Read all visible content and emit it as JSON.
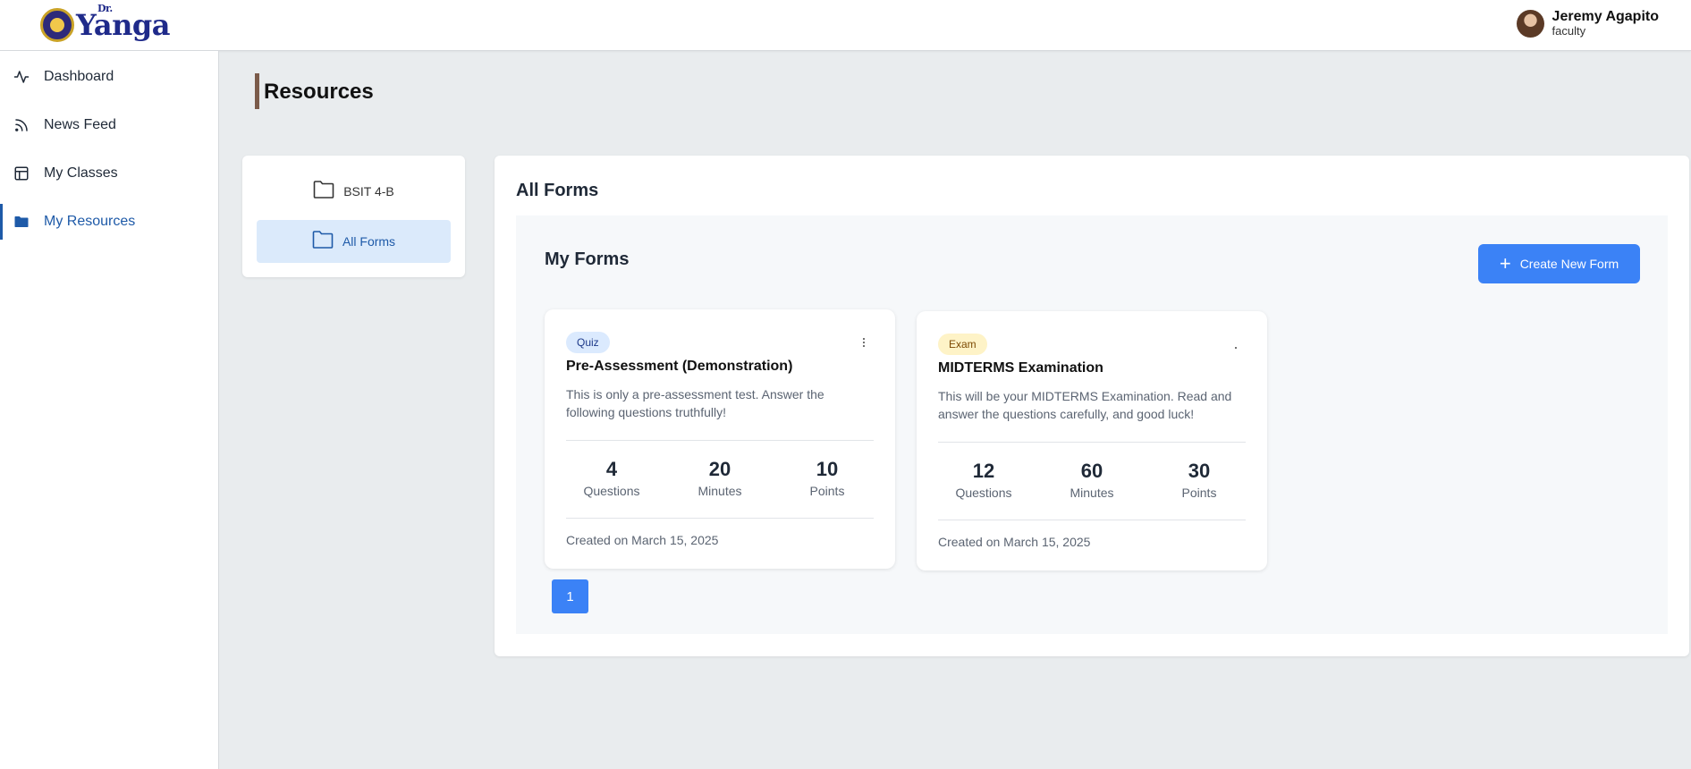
{
  "brand": {
    "logo_prefix": "Dr.",
    "logo_text": "Yanga"
  },
  "user": {
    "name": "Jeremy Agapito",
    "role": "faculty"
  },
  "sidebar": {
    "items": [
      {
        "label": "Dashboard",
        "icon": "activity-icon",
        "active": false
      },
      {
        "label": "News Feed",
        "icon": "rss-icon",
        "active": false
      },
      {
        "label": "My Classes",
        "icon": "layout-icon",
        "active": false
      },
      {
        "label": "My Resources",
        "icon": "folder-icon",
        "active": true
      }
    ]
  },
  "page": {
    "title": "Resources"
  },
  "folders": [
    {
      "label": "BSIT 4-B",
      "selected": false
    },
    {
      "label": "All Forms",
      "selected": true
    }
  ],
  "main": {
    "title": "All Forms",
    "section_title": "My Forms",
    "create_button": "Create New Form"
  },
  "forms": [
    {
      "badge": "Quiz",
      "title": "Pre-Assessment (Demonstration)",
      "description": "This is only a pre-assessment test. Answer the following questions truthfully!",
      "stats": [
        {
          "value": "4",
          "label": "Questions"
        },
        {
          "value": "20",
          "label": "Minutes"
        },
        {
          "value": "10",
          "label": "Points"
        }
      ],
      "created": "Created on March 15, 2025"
    },
    {
      "badge": "Exam",
      "title": "MIDTERMS Examination",
      "description": "This will be your MIDTERMS Examination. Read and answer the questions carefully, and good luck!",
      "stats": [
        {
          "value": "12",
          "label": "Questions"
        },
        {
          "value": "60",
          "label": "Minutes"
        },
        {
          "value": "30",
          "label": "Points"
        }
      ],
      "created": "Created on March 15, 2025"
    }
  ],
  "pagination": {
    "current_page": "1"
  },
  "colors": {
    "accent": "#3b82f6",
    "active_nav": "#1e5aa8",
    "title_bar": "#7b5b4a",
    "quiz_badge": "#dbeafe",
    "exam_badge": "#fef3c7"
  }
}
